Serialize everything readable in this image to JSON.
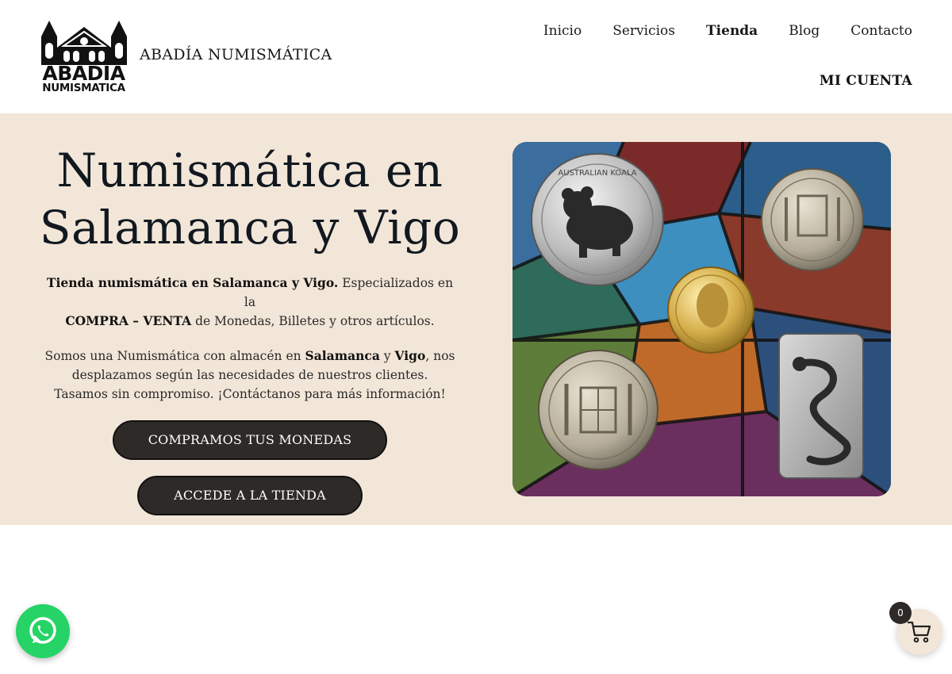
{
  "brand": {
    "logo_line1": "ABADIA",
    "logo_line2": "NUMISMATICA",
    "name": "ABADÍA NUMISMÁTICA"
  },
  "nav": {
    "items": [
      {
        "label": "Inicio",
        "active": false
      },
      {
        "label": "Servicios",
        "active": false
      },
      {
        "label": "Tienda",
        "active": true
      },
      {
        "label": "Blog",
        "active": false
      },
      {
        "label": "Contacto",
        "active": false
      }
    ],
    "account": "MI CUENTA"
  },
  "hero": {
    "title_line1": "Numismática en",
    "title_line2": "Salamanca y Vigo",
    "p1": {
      "bold": "Tienda numismática en Salamanca y Vigo.",
      "text": " Especializados en la ",
      "bold2": "COMPRA – VENTA",
      "text2": " de Monedas, Billetes y otros artículos."
    },
    "p2": {
      "text1": "Somos una Numismática con almacén en ",
      "bold1": "Salamanca",
      "text2": " y ",
      "bold2": "Vigo",
      "text3": ", nos desplazamos según las necesidades de nuestros clientes. Tasamos sin compromiso. ¡Contáctanos para más información!"
    },
    "button_buy": "COMPRAMOS TUS MONEDAS",
    "button_shop": "ACCEDE A LA TIENDA",
    "image_coin_text": "AUSTRALIAN KOALA"
  },
  "floating": {
    "whatsapp_icon": "whatsapp-icon",
    "cart_icon": "cart-icon",
    "cart_count": "0"
  },
  "colors": {
    "hero_bg": "#f2e6d8",
    "button_bg": "#2e2a28",
    "whatsapp": "#25d366"
  }
}
